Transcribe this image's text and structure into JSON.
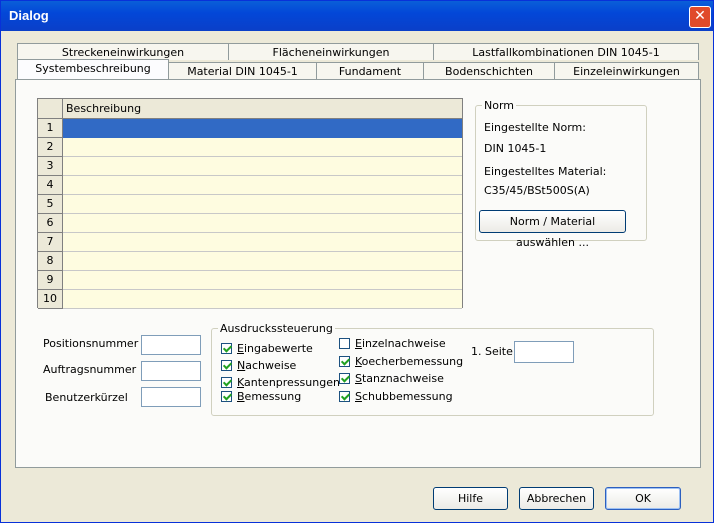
{
  "window": {
    "title": "Dialog"
  },
  "tabs_back": [
    "Streckeneinwirkungen",
    "Flächeneinwirkungen",
    "Lastfallkombinationen DIN 1045-1"
  ],
  "tabs_front": [
    "Systembeschreibung",
    "Material DIN 1045-1",
    "Fundament",
    "Bodenschichten",
    "Einzeleinwirkungen"
  ],
  "grid": {
    "column": "Beschreibung",
    "rows": [
      "1",
      "2",
      "3",
      "4",
      "5",
      "6",
      "7",
      "8",
      "9",
      "10"
    ],
    "selected_row": "1"
  },
  "norm": {
    "legend": "Norm",
    "norm_label": "Eingestellte Norm:",
    "norm_value": "DIN 1045-1",
    "material_label": "Eingestelltes Material:",
    "material_value": "C35/45/BSt500S(A)",
    "button": "Norm / Material auswählen ..."
  },
  "fields": {
    "positionsnummer": "Positionsnummer",
    "auftragsnummer": "Auftragsnummer",
    "benutzerkuerzel": "Benutzerkürzel"
  },
  "print": {
    "legend": "Ausdruckssteuerung",
    "col1": [
      {
        "first": "E",
        "rest": "ingabewerte",
        "checked": true
      },
      {
        "first": "N",
        "rest": "achweise",
        "checked": true
      },
      {
        "first": "K",
        "rest": "antenpressungen",
        "checked": true
      },
      {
        "first": "B",
        "rest": "emessung",
        "checked": true
      }
    ],
    "col2": [
      {
        "first": "E",
        "rest": "inzelnachweise",
        "checked": false
      },
      {
        "first": "K",
        "rest": "oecherbemessung",
        "checked": true
      },
      {
        "first": "S",
        "rest": "tanznachweise",
        "checked": true
      },
      {
        "first": "S",
        "rest": "chubbemessung",
        "checked": true
      }
    ],
    "seite_label": "1. Seite"
  },
  "buttons": {
    "hilfe": "Hilfe",
    "abbrechen": "Abbrechen",
    "ok": "OK"
  }
}
